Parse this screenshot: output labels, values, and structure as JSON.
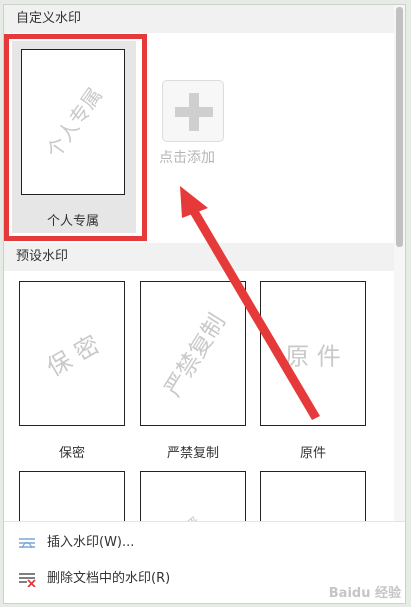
{
  "custom_section": {
    "header": "自定义水印",
    "item": {
      "watermark_text": "个人专属",
      "label": "个人专属"
    },
    "add_label": "点击添加"
  },
  "preset_section": {
    "header": "预设水印",
    "items": [
      {
        "watermark_text": "保 密",
        "label": "保密"
      },
      {
        "watermark_text": "严禁复制",
        "label": "严禁复制"
      },
      {
        "watermark_text": "原 件",
        "label": "原件"
      }
    ],
    "partial_row_text": [
      "",
      "严",
      ""
    ]
  },
  "menu": {
    "insert_label": "插入水印(W)...",
    "delete_label": "删除文档中的水印(R)"
  },
  "watermark_logo": "Baidu 经验",
  "colors": {
    "highlight": "#e63a3a",
    "arrow": "#e63a3a"
  },
  "icons": [
    "plus-icon",
    "insert-watermark-icon",
    "delete-watermark-icon"
  ]
}
